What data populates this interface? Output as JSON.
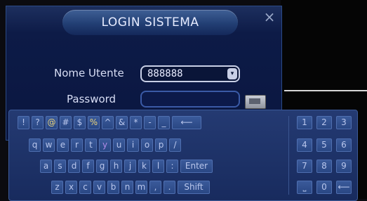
{
  "dialog": {
    "title": "LOGIN SISTEMA",
    "close_glyph": "×",
    "username_label": "Nome Utente",
    "username_value": "888888",
    "dropdown_glyph": "▾",
    "password_label": "Password",
    "password_value": ""
  },
  "keyboard": {
    "rows": [
      [
        "!",
        "?",
        "@",
        "#",
        "$",
        "%",
        "^",
        "&",
        "*",
        "-",
        "_",
        "⟵"
      ],
      [
        "q",
        "w",
        "e",
        "r",
        "t",
        "y",
        "u",
        "i",
        "o",
        "p",
        "/"
      ],
      [
        "a",
        "s",
        "d",
        "f",
        "g",
        "h",
        "j",
        "k",
        "l",
        ":",
        "Enter"
      ],
      [
        "z",
        "x",
        "c",
        "v",
        "b",
        "n",
        "m",
        ",",
        ".",
        "Shift"
      ]
    ],
    "numpad": [
      [
        "1",
        "2",
        "3"
      ],
      [
        "4",
        "5",
        "6"
      ],
      [
        "7",
        "8",
        "9"
      ],
      [
        "⎵",
        "0",
        "⟵"
      ]
    ]
  },
  "colors": {
    "dialog_bg": "#0a1640",
    "key_text": "#b9c6ec",
    "highlight_text": "#e9d27a"
  }
}
